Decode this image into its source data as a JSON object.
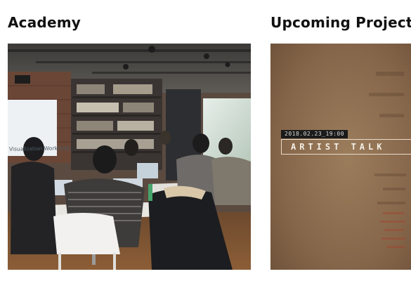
{
  "academy": {
    "title": "Academy",
    "photo_screen_text": "Visualization Workshop"
  },
  "upcoming": {
    "title": "Upcoming Project",
    "event_date": "2018.02.23_19:00",
    "event_title": "ARTIST TALK"
  },
  "colors": {
    "heading": "#111111",
    "poster_background": "#8a6a48",
    "poster_label_background": "#1b1b1b"
  }
}
